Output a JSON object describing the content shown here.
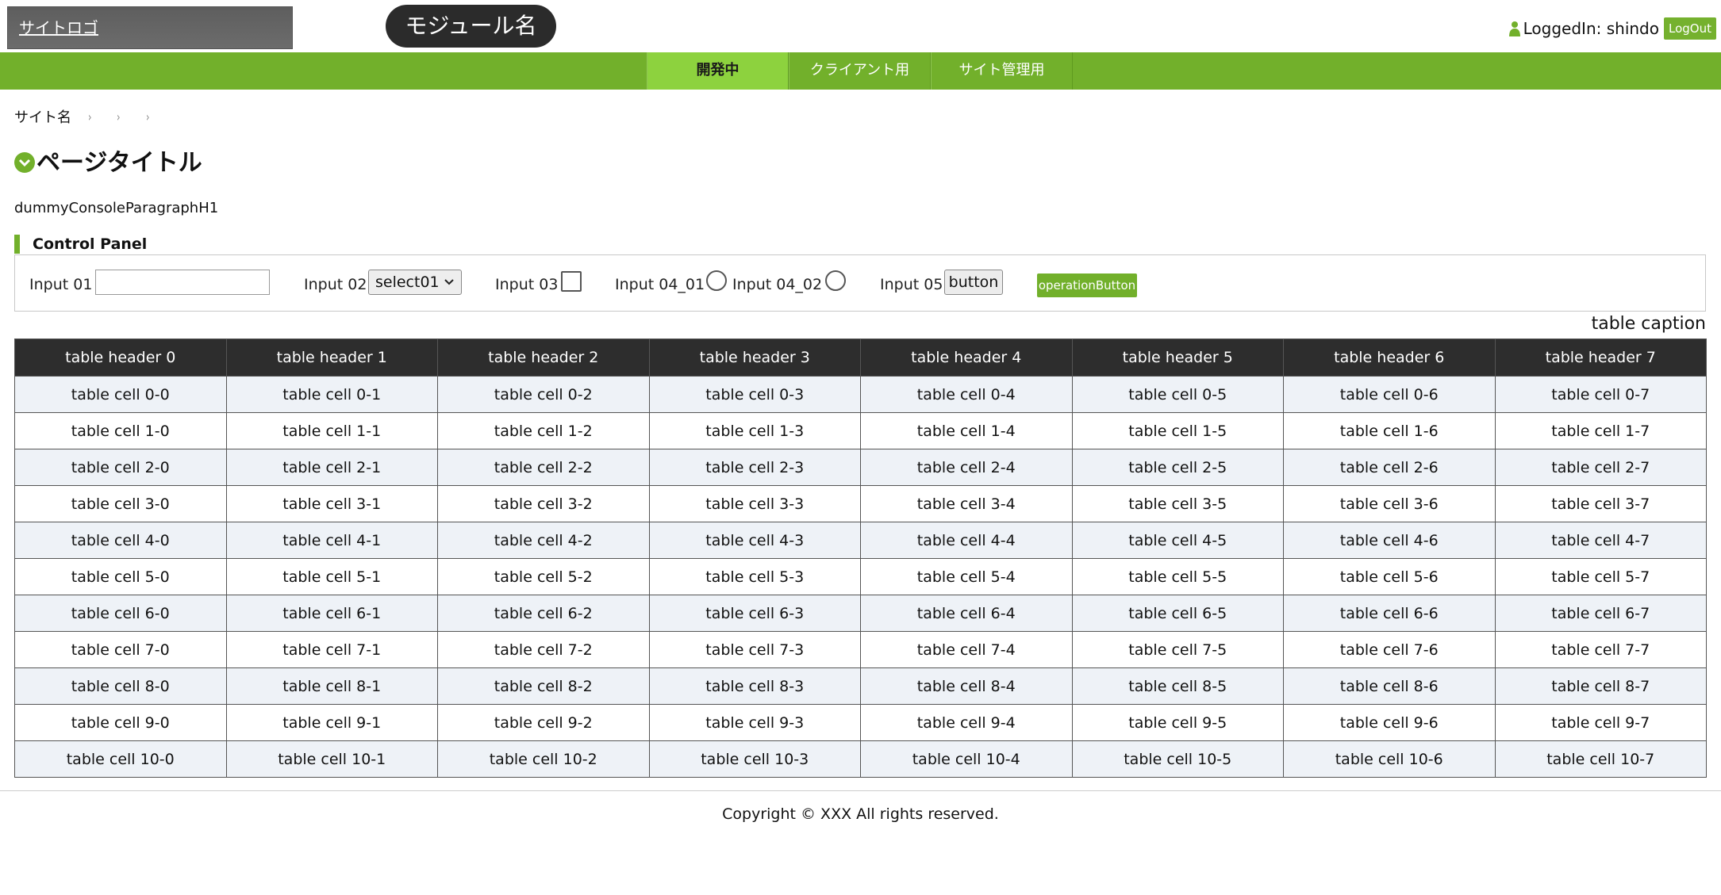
{
  "header": {
    "site_logo": "サイトロゴ",
    "module_name": "モジュール名",
    "logged_in": "LoggedIn: shindo",
    "logout": "LogOut"
  },
  "nav": {
    "tabs": [
      {
        "label": "開発中",
        "active": true
      },
      {
        "label": "クライアント用",
        "active": false
      },
      {
        "label": "サイト管理用",
        "active": false
      }
    ]
  },
  "breadcrumb": {
    "site_name": "サイト名",
    "separator": "›"
  },
  "page": {
    "title": "ページタイトル",
    "console_paragraph": "dummyConsoleParagraphH1"
  },
  "control_panel": {
    "heading": "Control Panel",
    "input01_label": "Input 01",
    "input01_value": "",
    "input02_label": "Input 02",
    "input02_selected": "select01",
    "input03_label": "Input 03",
    "input04_01_label": "Input 04_01",
    "input04_02_label": "Input 04_02",
    "input05_label": "Input 05",
    "input05_button": "button",
    "operation_button": "operationButton"
  },
  "table": {
    "caption": "table caption",
    "headers": [
      "table header 0",
      "table header 1",
      "table header 2",
      "table header 3",
      "table header 4",
      "table header 5",
      "table header 6",
      "table header 7"
    ],
    "rows": [
      [
        "table cell 0-0",
        "table cell 0-1",
        "table cell 0-2",
        "table cell 0-3",
        "table cell 0-4",
        "table cell 0-5",
        "table cell 0-6",
        "table cell 0-7"
      ],
      [
        "table cell 1-0",
        "table cell 1-1",
        "table cell 1-2",
        "table cell 1-3",
        "table cell 1-4",
        "table cell 1-5",
        "table cell 1-6",
        "table cell 1-7"
      ],
      [
        "table cell 2-0",
        "table cell 2-1",
        "table cell 2-2",
        "table cell 2-3",
        "table cell 2-4",
        "table cell 2-5",
        "table cell 2-6",
        "table cell 2-7"
      ],
      [
        "table cell 3-0",
        "table cell 3-1",
        "table cell 3-2",
        "table cell 3-3",
        "table cell 3-4",
        "table cell 3-5",
        "table cell 3-6",
        "table cell 3-7"
      ],
      [
        "table cell 4-0",
        "table cell 4-1",
        "table cell 4-2",
        "table cell 4-3",
        "table cell 4-4",
        "table cell 4-5",
        "table cell 4-6",
        "table cell 4-7"
      ],
      [
        "table cell 5-0",
        "table cell 5-1",
        "table cell 5-2",
        "table cell 5-3",
        "table cell 5-4",
        "table cell 5-5",
        "table cell 5-6",
        "table cell 5-7"
      ],
      [
        "table cell 6-0",
        "table cell 6-1",
        "table cell 6-2",
        "table cell 6-3",
        "table cell 6-4",
        "table cell 6-5",
        "table cell 6-6",
        "table cell 6-7"
      ],
      [
        "table cell 7-0",
        "table cell 7-1",
        "table cell 7-2",
        "table cell 7-3",
        "table cell 7-4",
        "table cell 7-5",
        "table cell 7-6",
        "table cell 7-7"
      ],
      [
        "table cell 8-0",
        "table cell 8-1",
        "table cell 8-2",
        "table cell 8-3",
        "table cell 8-4",
        "table cell 8-5",
        "table cell 8-6",
        "table cell 8-7"
      ],
      [
        "table cell 9-0",
        "table cell 9-1",
        "table cell 9-2",
        "table cell 9-3",
        "table cell 9-4",
        "table cell 9-5",
        "table cell 9-6",
        "table cell 9-7"
      ],
      [
        "table cell 10-0",
        "table cell 10-1",
        "table cell 10-2",
        "table cell 10-3",
        "table cell 10-4",
        "table cell 10-5",
        "table cell 10-6",
        "table cell 10-7"
      ]
    ]
  },
  "footer": {
    "copyright": "Copyright © XXX All rights reserved."
  },
  "colors": {
    "accent_green": "#72b02b",
    "active_tab": "#8dd23e",
    "header_dark": "#2d2d2d",
    "row_alt": "#eef2f7"
  },
  "icons": {
    "user": "user-icon",
    "title": "chevron-circle-down-icon",
    "select": "chevron-down-icon",
    "breadcrumb_separator": "chevron-right-icon"
  }
}
